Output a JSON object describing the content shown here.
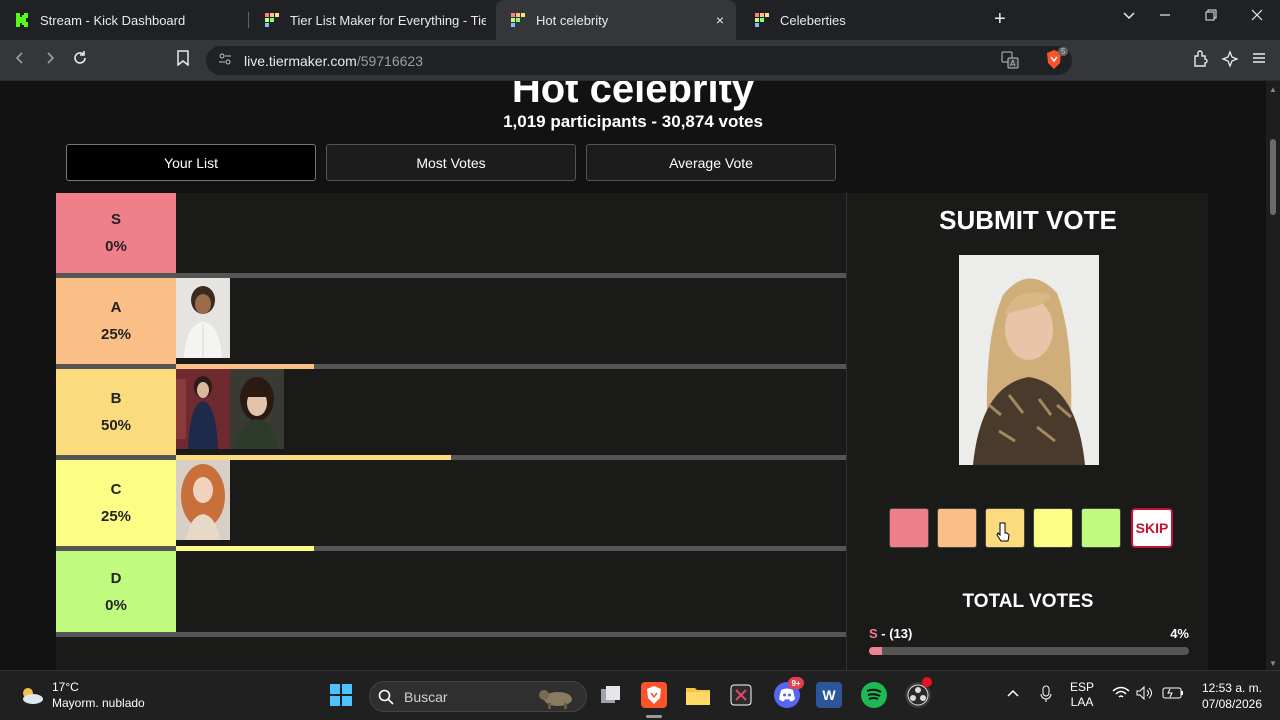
{
  "browser": {
    "tabs": [
      {
        "title": "Stream - Kick Dashboard",
        "favicon": "kick-icon"
      },
      {
        "title": "Tier List Maker for Everything - TierMaker",
        "favicon": "tiermaker-icon"
      },
      {
        "title": "Hot celebrity",
        "favicon": "tiermaker-icon",
        "active": true
      },
      {
        "title": "Celeberties",
        "favicon": "tiermaker-icon"
      }
    ],
    "close_tab_label": "×",
    "new_tab_label": "+",
    "url_host": "live.tiermaker.com",
    "url_path": "/59716623",
    "shield_badge": "5"
  },
  "page": {
    "title": "Hot celebrity",
    "stats": "1,019 participants - 30,874 votes",
    "view_tabs": [
      {
        "label": "Your List",
        "active": true
      },
      {
        "label": "Most Votes",
        "active": false
      },
      {
        "label": "Average Vote",
        "active": false
      }
    ]
  },
  "tiers": [
    {
      "letter": "S",
      "pct": "0%",
      "fraction": 0.0,
      "color": "#f07f8c",
      "items": 0
    },
    {
      "letter": "A",
      "pct": "25%",
      "fraction": 0.25,
      "color": "#f9bf86",
      "items": 1
    },
    {
      "letter": "B",
      "pct": "50%",
      "fraction": 0.5,
      "color": "#fadb7e",
      "items": 2
    },
    {
      "letter": "C",
      "pct": "25%",
      "fraction": 0.25,
      "color": "#fbfd84",
      "items": 1
    },
    {
      "letter": "D",
      "pct": "0%",
      "fraction": 0.0,
      "color": "#c0fb80",
      "items": 0
    }
  ],
  "submit": {
    "title": "SUBMIT VOTE",
    "skip_label": "SKIP",
    "vote_colors": [
      "#f07f8c",
      "#f9bf86",
      "#fadb7e",
      "#fbfd84",
      "#c0fb80"
    ]
  },
  "total_votes": {
    "title": "TOTAL VOTES",
    "rows": [
      {
        "letter": "S",
        "count": " - (13)",
        "pct": "4%",
        "fraction": 0.04
      }
    ]
  },
  "taskbar": {
    "weather_temp": "17°C",
    "weather_desc": "Mayorm. nublado",
    "search_placeholder": "Buscar",
    "lang_line1": "ESP",
    "lang_line2": "LAA",
    "time": "12:53 a. m.",
    "date": "07/08/2026",
    "discord_badge": "9+"
  }
}
